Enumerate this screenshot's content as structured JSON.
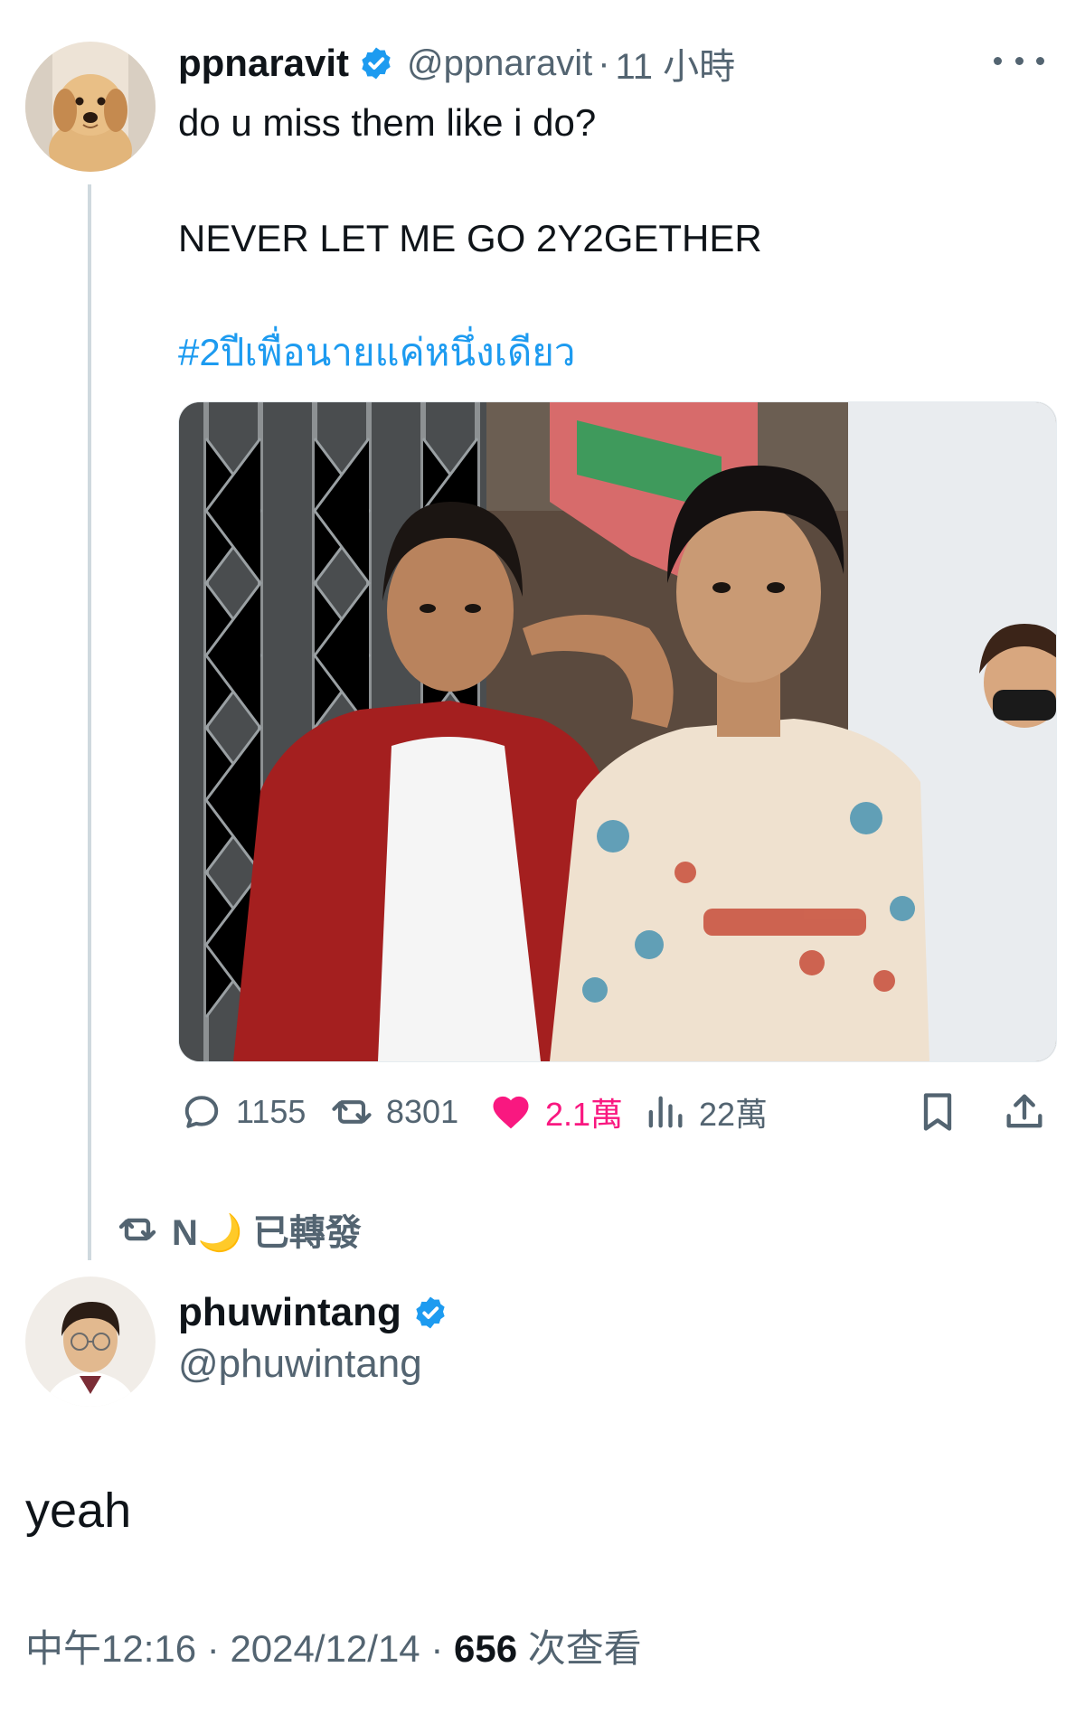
{
  "original_tweet": {
    "display_name": "ppnaravit",
    "handle": "@ppnaravit",
    "separator": "·",
    "time": "11 小時",
    "text_line1": "do u miss them like i do?",
    "text_line2": "NEVER LET ME GO 2Y2GETHER",
    "hashtag": "#2ปีเพื่อนายแค่หนึ่งเดียว",
    "actions": {
      "replies": "1155",
      "retweets": "8301",
      "likes": "2.1萬",
      "views": "22萬"
    }
  },
  "retweet_banner": {
    "label": "N🌙 已轉發"
  },
  "reply_tweet": {
    "display_name": "phuwintang",
    "handle": "@phuwintang",
    "text": "yeah",
    "time": "中午12:16",
    "separator": "·",
    "date": "2024/12/14",
    "view_count": "656",
    "view_label": "次查看"
  },
  "colors": {
    "accent": "#1d9bf0",
    "like": "#f91880",
    "muted": "#536471",
    "text": "#0f1419"
  }
}
